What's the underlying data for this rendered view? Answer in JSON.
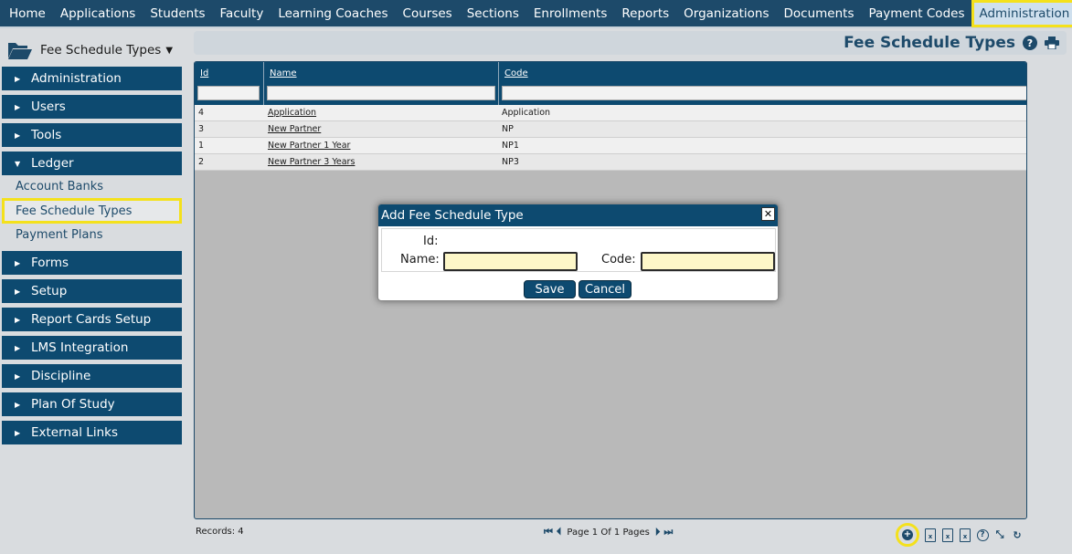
{
  "nav": {
    "items": [
      "Home",
      "Applications",
      "Students",
      "Faculty",
      "Learning Coaches",
      "Courses",
      "Sections",
      "Enrollments",
      "Reports",
      "Organizations",
      "Documents",
      "Payment Codes",
      "Administration"
    ]
  },
  "sidebar": {
    "context_label": "Fee Schedule Types",
    "groups_top": [
      "Administration",
      "Users",
      "Tools"
    ],
    "ledger": {
      "label": "Ledger",
      "items": [
        "Account Banks",
        "Fee Schedule Types",
        "Payment Plans"
      ]
    },
    "groups_bottom": [
      "Forms",
      "Setup",
      "Report Cards Setup",
      "LMS Integration",
      "Discipline",
      "Plan Of Study",
      "External Links"
    ]
  },
  "page": {
    "title": "Fee Schedule Types",
    "help_glyph": "?"
  },
  "grid": {
    "columns": [
      "Id",
      "Name",
      "Code"
    ],
    "rows": [
      {
        "id": "4",
        "name": "Application",
        "code": "Application"
      },
      {
        "id": "3",
        "name": "New Partner",
        "code": "NP"
      },
      {
        "id": "1",
        "name": "New Partner 1 Year",
        "code": "NP1"
      },
      {
        "id": "2",
        "name": "New Partner 3 Years",
        "code": "NP3"
      }
    ]
  },
  "footer": {
    "records": "Records: 4",
    "page_label": "Page 1 Of 1 Pages"
  },
  "dialog": {
    "title": "Add Fee Schedule Type",
    "close_glyph": "✕",
    "id_label": "Id:",
    "name_label": "Name:",
    "code_label": "Code:",
    "name_value": "",
    "code_value": "",
    "save_label": "Save",
    "cancel_label": "Cancel"
  },
  "colors": {
    "brand": "#0d4a70",
    "highlight": "#f4e11c",
    "input_bg": "#fdf7c8"
  }
}
